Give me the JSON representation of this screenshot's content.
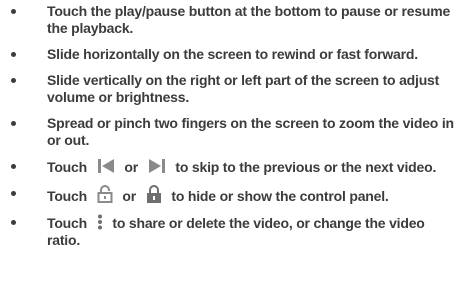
{
  "bullets": [
    {
      "text": "Touch the play/pause button at the bottom to pause or resume the playback."
    },
    {
      "text": "Slide horizontally on the screen to rewind or fast forward."
    },
    {
      "text": "Slide vertically on the right or left part of the screen to adjust volume or brightness."
    },
    {
      "text": "Spread or pinch two fingers on the screen to zoom the video in or out."
    },
    {
      "pre": "Touch",
      "icon1": "skip-previous-icon",
      "mid": "or",
      "icon2": "skip-next-icon",
      "post": "to skip to the previous or the next video."
    },
    {
      "pre": "Touch",
      "icon1": "unlock-icon",
      "mid": "or",
      "icon2": "lock-icon",
      "post": "to hide or show the control panel."
    },
    {
      "pre": "Touch",
      "icon1": "more-vertical-icon",
      "post": "to share or delete the video, or change the video ratio."
    }
  ],
  "colors": {
    "text": "#3c3c3c",
    "icon": "#8a8a8a"
  }
}
